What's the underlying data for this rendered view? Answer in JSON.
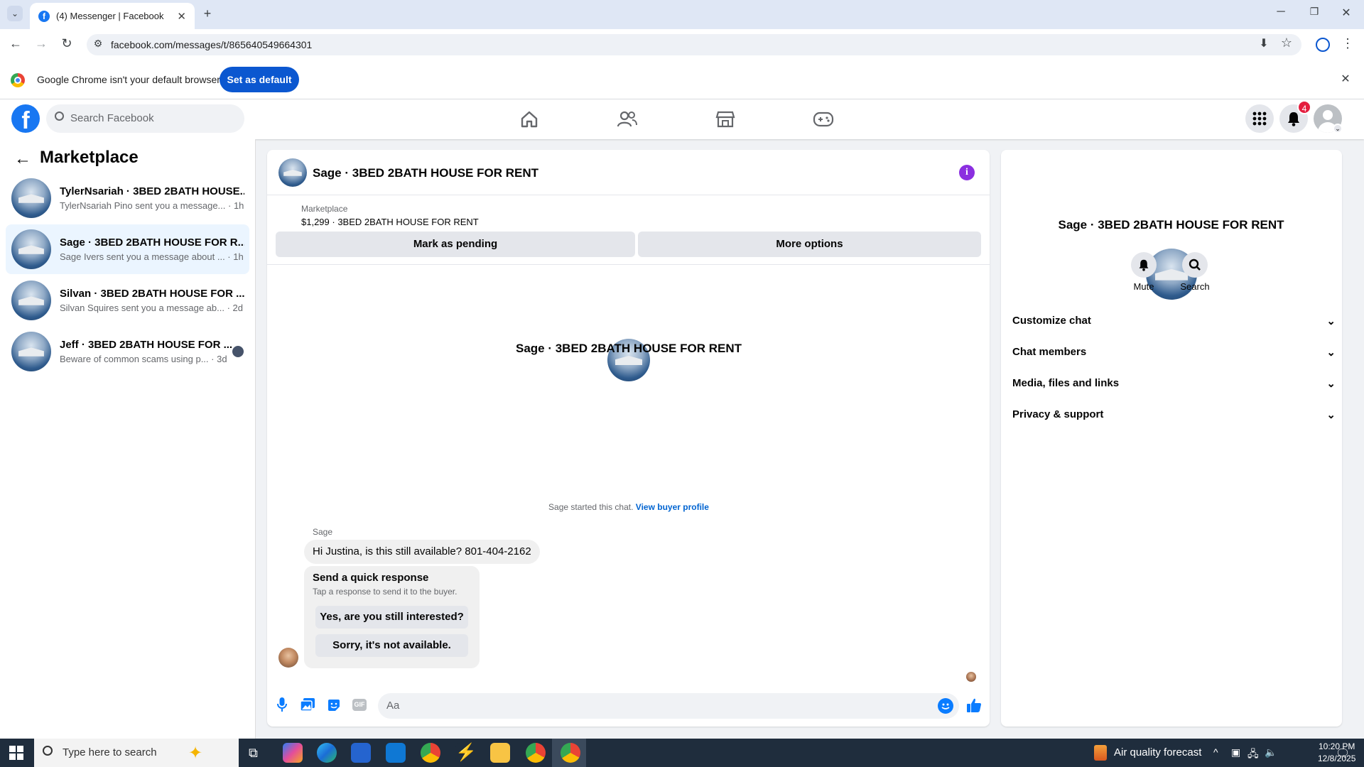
{
  "browser": {
    "tab_title": "(4) Messenger | Facebook",
    "url": "facebook.com/messages/t/865640549664301",
    "infobar_text": "Google Chrome isn't your default browser",
    "set_default_label": "Set as default"
  },
  "fb": {
    "search_placeholder": "Search Facebook",
    "notification_count": "4"
  },
  "left": {
    "title": "Marketplace",
    "conversations": [
      {
        "name": "TylerNsariah · 3BED 2BATH HOUSE...",
        "preview": "TylerNsariah Pino sent you a message... · 1h"
      },
      {
        "name": "Sage · 3BED 2BATH HOUSE FOR R...",
        "preview": "Sage Ivers sent you a message about ... · 1h"
      },
      {
        "name": "Silvan · 3BED 2BATH HOUSE FOR ...",
        "preview": "Silvan Squires sent you a message ab... · 2d"
      },
      {
        "name": "Jeff · 3BED 2BATH HOUSE FOR ...",
        "preview": "Beware of common scams using p... · 3d"
      }
    ]
  },
  "chat": {
    "title": "Sage · 3BED 2BATH HOUSE FOR RENT",
    "listing_source": "Marketplace",
    "listing_line": "$1,299 · 3BED 2BATH HOUSE FOR RENT",
    "mark_pending_label": "Mark as pending",
    "more_options_label": "More options",
    "intro_name": "Sage · 3BED 2BATH HOUSE FOR RENT",
    "started_text": "Sage started this chat.",
    "view_profile_label": "View buyer profile",
    "sender_name": "Sage",
    "message": "Hi Justina, is this still available? 801-404-2162",
    "quick_title": "Send a quick response",
    "quick_sub": "Tap a response to send it to the buyer.",
    "quick_1": "Yes, are you still interested?",
    "quick_2": "Sorry, it's not available.",
    "composer_placeholder": "Aa",
    "gif_label": "GIF"
  },
  "right": {
    "name": "Sage · 3BED 2BATH HOUSE FOR RENT",
    "mute_label": "Mute",
    "search_label": "Search",
    "sections": [
      "Customize chat",
      "Chat members",
      "Media, files and links",
      "Privacy & support"
    ]
  },
  "taskbar": {
    "search_placeholder": "Type here to search",
    "weather": "Air quality forecast",
    "time": "10:20 PM",
    "date": "12/8/2025"
  },
  "colors": {
    "facebook_blue": "#1877f2",
    "link_blue": "#0064d1",
    "info_purple": "#8b2fe0",
    "badge_red": "#e41e3f"
  }
}
